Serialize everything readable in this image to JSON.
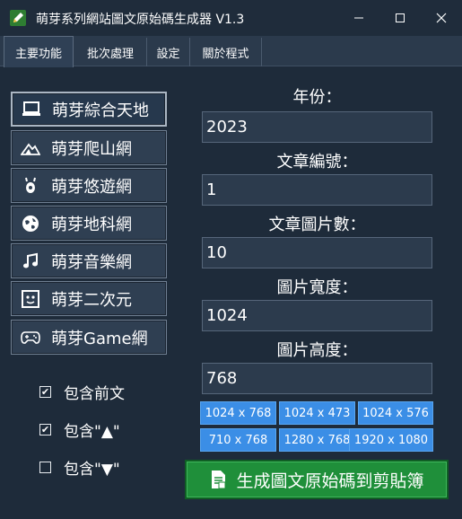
{
  "window": {
    "title": "萌芽系列網站圖文原始碼生成器 V1.3"
  },
  "tabs": [
    {
      "label": "主要功能",
      "active": true
    },
    {
      "label": "批次處理",
      "active": false
    },
    {
      "label": "設定",
      "active": false
    },
    {
      "label": "關於程式",
      "active": false
    }
  ],
  "sites": [
    {
      "label": "萌芽綜合天地",
      "icon": "laptop-icon",
      "selected": true
    },
    {
      "label": "萌芽爬山網",
      "icon": "mountain-icon",
      "selected": false
    },
    {
      "label": "萌芽悠遊網",
      "icon": "travel-icon",
      "selected": false
    },
    {
      "label": "萌芽地科網",
      "icon": "globe-icon",
      "selected": false
    },
    {
      "label": "萌芽音樂網",
      "icon": "music-note-icon",
      "selected": false
    },
    {
      "label": "萌芽二次元",
      "icon": "anime-icon",
      "selected": false
    },
    {
      "label": "萌芽Game網",
      "icon": "gamepad-icon",
      "selected": false
    }
  ],
  "options": [
    {
      "label": "包含前文",
      "checked": true
    },
    {
      "label": "包含\"▲\"",
      "checked": true
    },
    {
      "label": "包含\"▼\"",
      "checked": false
    }
  ],
  "fields": {
    "year": {
      "label": "年份：",
      "value": "2023"
    },
    "article_no": {
      "label": "文章編號：",
      "value": "1"
    },
    "image_count": {
      "label": "文章圖片數：",
      "value": "10"
    },
    "image_width": {
      "label": "圖片寬度：",
      "value": "1024"
    },
    "image_height": {
      "label": "圖片高度：",
      "value": "768"
    }
  },
  "presets": [
    "1024 x 768",
    "1024 x 473",
    "1024 x 576",
    "710 x 768",
    "1280 x 768",
    "1920 x 1080"
  ],
  "generate_label": "生成圖文原始碼到剪貼簿",
  "colors": {
    "background": "#1e2b3a",
    "preset": "#3b8ee6",
    "generate": "#1f8f3a"
  }
}
